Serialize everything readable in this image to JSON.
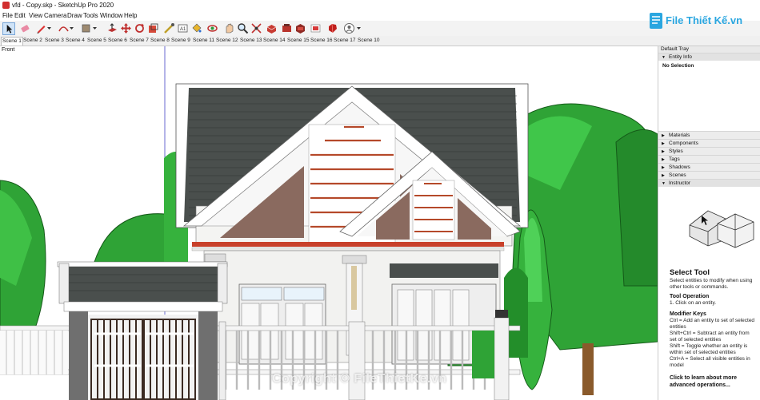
{
  "app": {
    "title": "vfd - Copy.skp - SketchUp Pro 2020"
  },
  "menu": [
    "File",
    "Edit",
    "View",
    "Camera",
    "Draw",
    "Tools",
    "Window",
    "Help"
  ],
  "toolbar": {
    "icons": [
      "select-icon",
      "eraser-icon",
      "pencil-icon",
      "pencil-dropdown-icon",
      "arc-icon",
      "arc-dropdown-icon",
      "rectangle-icon",
      "rectangle-dropdown-icon",
      "push-pull-icon",
      "move-icon",
      "rotate-icon",
      "scale-icon",
      "tape-measure-icon",
      "text-icon",
      "paint-bucket-icon",
      "orbit-icon",
      "pan-icon",
      "zoom-icon",
      "zoom-extents-icon",
      "3d-warehouse-icon",
      "extension-warehouse-icon",
      "layout-icon",
      "extension-manager-icon",
      "ruby-icon",
      "account-icon",
      "account-dropdown-icon"
    ]
  },
  "scenes": [
    "Scene 1",
    "Scene 2",
    "Scene 3",
    "Scene 4",
    "Scene 5",
    "Scene 6",
    "Scene 7",
    "Scene 8",
    "Scene 9",
    "Scene 11",
    "Scene 12",
    "Scene 13",
    "Scene 14",
    "Scene 15",
    "Scene 16",
    "Scene 17",
    "Scene 10"
  ],
  "viewport": {
    "label": "Front"
  },
  "tray": {
    "title": "Default Tray",
    "entity_info": "Entity Info",
    "selection": "No Selection",
    "panels": [
      "Materials",
      "Components",
      "Styles",
      "Tags",
      "Shadows",
      "Scenes",
      "Instructor"
    ],
    "instructor": {
      "title": "Select Tool",
      "desc": "Select entities to modify when using other tools or commands.",
      "op_head": "Tool Operation",
      "op_text": "1. Click on an entity.",
      "mod_head": "Modifier Keys",
      "mod_lines": [
        "Ctrl = Add an entity to set of selected entities",
        "Shift+Ctrl = Subtract an entity from set of selected entities",
        "Shift = Toggle whether an entity is within set of selected entities",
        "Ctrl+A = Select all visible entities in model"
      ],
      "learn_more": "Click to learn about more advanced operations..."
    }
  },
  "watermark": {
    "logo_text": "File Thiết Kế.vn",
    "bottom_text": "Copyright © FileThietKe.vn"
  },
  "colors": {
    "roof": "#4a4f4d",
    "brick": "#8a6a5f",
    "stripe": "#b5492a",
    "tree": "#2fa336",
    "tree_dark": "#1d7a24",
    "logo": "#2aa6e0"
  }
}
